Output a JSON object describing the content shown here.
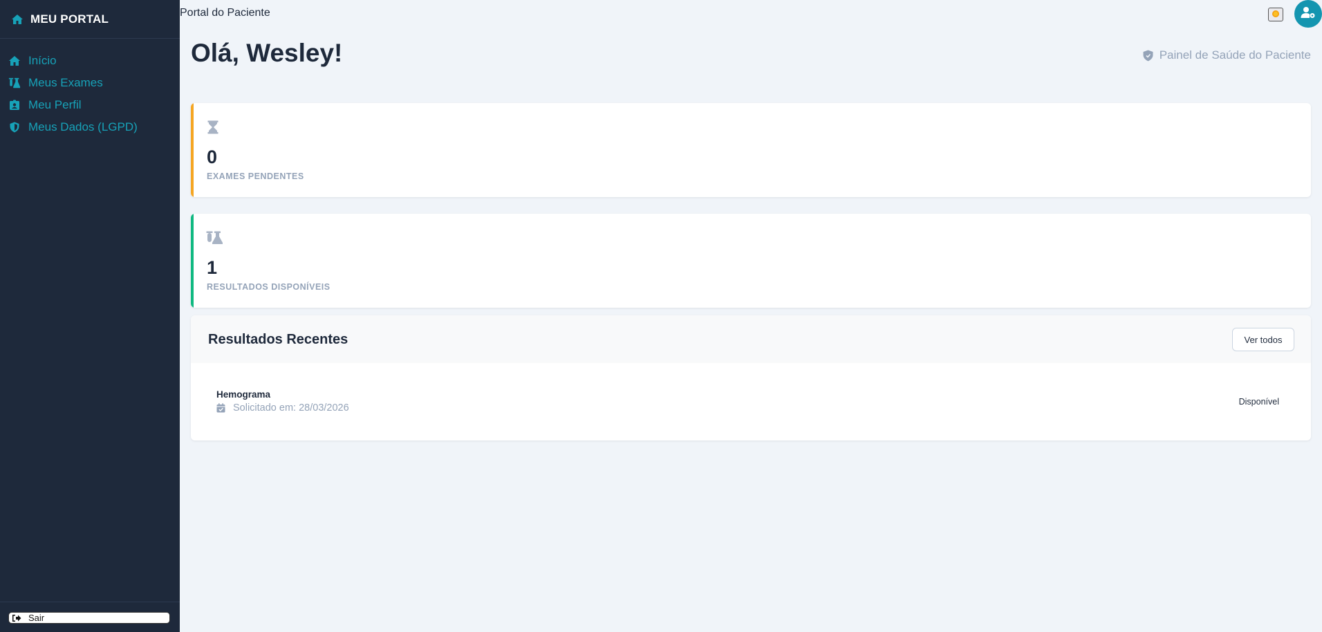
{
  "sidebar": {
    "brand": "MEU PORTAL",
    "items": [
      {
        "label": "Início",
        "icon": "home-icon"
      },
      {
        "label": "Meus Exames",
        "icon": "flask-icon"
      },
      {
        "label": "Meu Perfil",
        "icon": "id-badge-icon"
      },
      {
        "label": "Meus Dados (LGPD)",
        "icon": "shield-icon"
      }
    ],
    "logout_label": "Sair"
  },
  "topbar": {
    "title": "Portal do Paciente"
  },
  "main": {
    "greeting": "Olá, Wesley!",
    "panel_label": "Painel de Saúde do Paciente",
    "stats": [
      {
        "value": "0",
        "caption": "EXAMES PENDENTES",
        "icon": "hourglass-icon",
        "accent": "#f5a623"
      },
      {
        "value": "1",
        "caption": "RESULTADOS DISPONÍVEIS",
        "icon": "flask-icon",
        "accent": "#10b981"
      }
    ],
    "recent": {
      "title": "Resultados Recentes",
      "view_all_label": "Ver todos",
      "items": [
        {
          "name": "Hemograma",
          "date": "Solicitado em: 28/03/2026",
          "status": "Disponível"
        }
      ]
    }
  },
  "colors": {
    "sidebar_bg": "#1e293b",
    "accent": "#17a2b8",
    "page_bg": "#f0f4f9"
  }
}
